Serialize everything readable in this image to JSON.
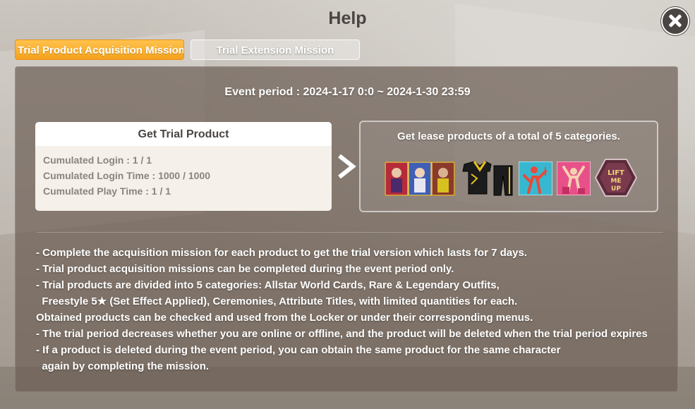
{
  "window": {
    "title": "Help"
  },
  "tabs": [
    {
      "label": "Trial Product Acquisition Mission",
      "active": true
    },
    {
      "label": "Trial Extension Mission",
      "active": false
    }
  ],
  "event": {
    "period_text": "Event period : 2024-1-17 0:0 ~ 2024-1-30 23:59"
  },
  "trial_box": {
    "header": "Get Trial Product",
    "items": [
      "Cumulated Login : 1 / 1",
      "Cumulated Login Time : 1000 / 1000",
      "Cumulated Play Time : 1 / 1"
    ]
  },
  "rewards": {
    "title": "Get lease products of a total of 5 categories.",
    "items": [
      {
        "icon": "allstar-cards-icon"
      },
      {
        "icon": "outfit-icon"
      },
      {
        "icon": "ceremony-icon"
      },
      {
        "icon": "ceremony-cheer-icon"
      },
      {
        "icon": "attribute-title-badge-icon",
        "badge_text": "LIFT ME UP"
      }
    ]
  },
  "notes": [
    "- Complete the acquisition mission for each product to get the trial version which lasts for 7 days.",
    "- Trial product acquisition missions can be completed during the event period only.",
    "- Trial products are divided into 5 categories: Allstar World Cards, Rare & Legendary Outfits,",
    "  Freestyle 5★ (Set Effect Applied), Ceremonies, Attribute Titles, with limited quantities for each.",
    "Obtained products can be checked and used from the Locker or under their corresponding menus.",
    "- The trial period decreases whether you are online or offline, and the product will be deleted when the trial period expires",
    "- If a product is deleted during the event period, you can obtain the same product for the same character",
    "  again by completing the mission."
  ],
  "colors": {
    "accent": "#f5a21c",
    "panel": "#6e6056",
    "text_dark": "#4a4542"
  }
}
